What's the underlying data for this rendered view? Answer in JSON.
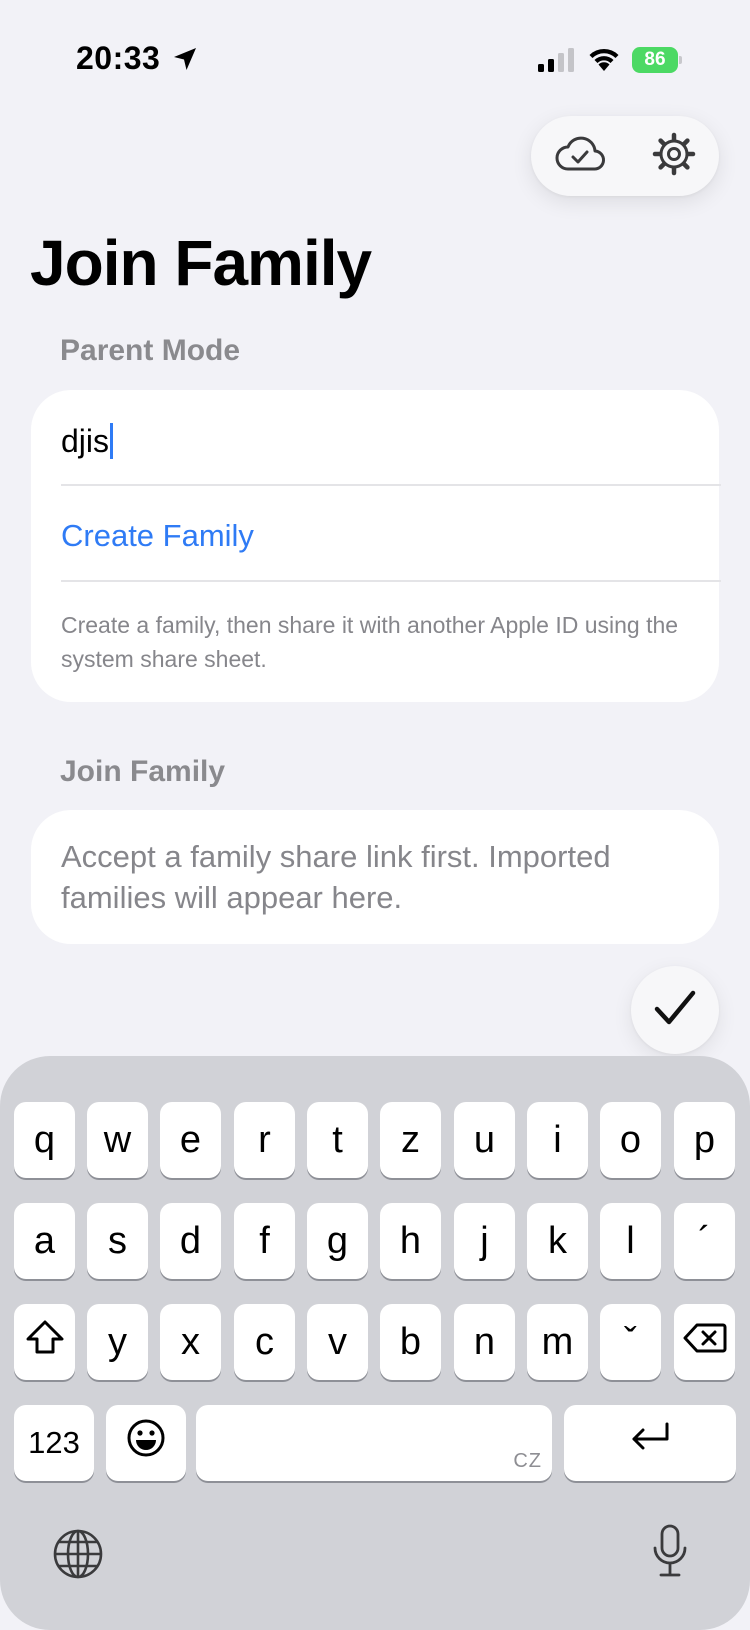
{
  "status_bar": {
    "time": "20:33",
    "battery": "86"
  },
  "toolbar": {
    "cloud_icon": "icloud-check-icon",
    "settings_icon": "gear-icon"
  },
  "page": {
    "title": "Join Family"
  },
  "parent_section": {
    "header": "Parent Mode",
    "name_value": "djis",
    "create_label": "Create Family",
    "footnote": "Create a family, then share it with another Apple ID using the system share sheet."
  },
  "join_section": {
    "header": "Join Family",
    "note": "Accept a family share link first. Imported families will appear here."
  },
  "keyboard": {
    "row1": [
      "q",
      "w",
      "e",
      "r",
      "t",
      "z",
      "u",
      "i",
      "o",
      "p"
    ],
    "row2": [
      "a",
      "s",
      "d",
      "f",
      "g",
      "h",
      "j",
      "k",
      "l",
      "´"
    ],
    "row3": [
      "y",
      "x",
      "c",
      "v",
      "b",
      "n",
      "m",
      "ˇ"
    ],
    "numbers_label": "123",
    "space_language": "CZ"
  },
  "colors": {
    "accent": "#2f7bf5",
    "background": "#f2f2f7",
    "battery": "#4cd964",
    "keyboard": "#d1d2d7"
  }
}
